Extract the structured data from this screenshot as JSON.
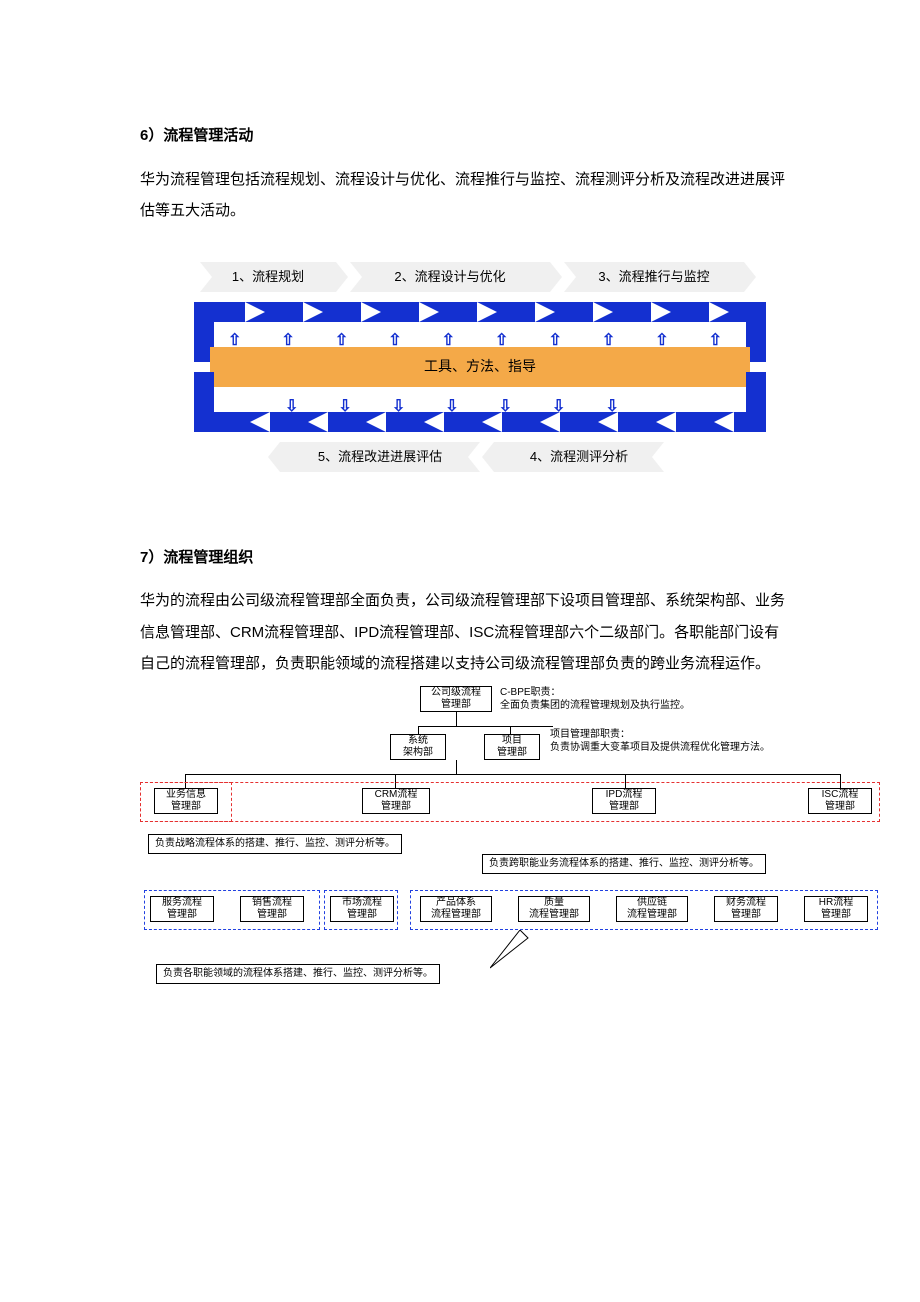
{
  "section6": {
    "title": "6）流程管理活动",
    "para": "华为流程管理包括流程规划、流程设计与优化、流程推行与监控、流程测评分析及流程改进进展评估等五大活动。"
  },
  "diagram1": {
    "top1": "1、流程规划",
    "top2": "2、流程设计与优化",
    "top3": "3、流程推行与监控",
    "center": "工具、方法、指导",
    "bot1": "5、流程改进进展评估",
    "bot2": "4、流程测评分析"
  },
  "section7": {
    "title": "7）流程管理组织",
    "para": "华为的流程由公司级流程管理部全面负责，公司级流程管理部下设项目管理部、系统架构部、业务信息管理部、CRM流程管理部、IPD流程管理部、ISC流程管理部六个二级部门。各职能部门设有自己的流程管理部，负责职能领域的流程搭建以支持公司级流程管理部负责的跨业务流程运作。"
  },
  "org": {
    "top": "公司级流程\n管理部",
    "topdesc": "C-BPE职责：\n全面负责集团的流程管理规划及执行监控。",
    "l2a": "系统\n架构部",
    "l2b": "项目\n管理部",
    "l2bdesc": "项目管理部职责：\n负责协调重大变革项目及提供流程优化管理方法。",
    "l3a": "业务信息\n管理部",
    "l3b": "CRM流程\n管理部",
    "l3c": "IPD流程\n管理部",
    "l3d": "ISC流程\n管理部",
    "callout1": "负责战略流程体系的搭建、推行、监控、测评分析等。",
    "callout2": "负责跨职能业务流程体系的搭建、推行、监控、测评分析等。",
    "l4a": "服务流程\n管理部",
    "l4b": "销售流程\n管理部",
    "l4c": "市场流程\n管理部",
    "l4d": "产品体系\n流程管理部",
    "l4e": "质量\n流程管理部",
    "l4f": "供应链\n流程管理部",
    "l4g": "财务流程\n管理部",
    "l4h": "HR流程\n管理部",
    "callout3": "负责各职能领域的流程体系搭建、推行、监控、测评分析等。"
  }
}
